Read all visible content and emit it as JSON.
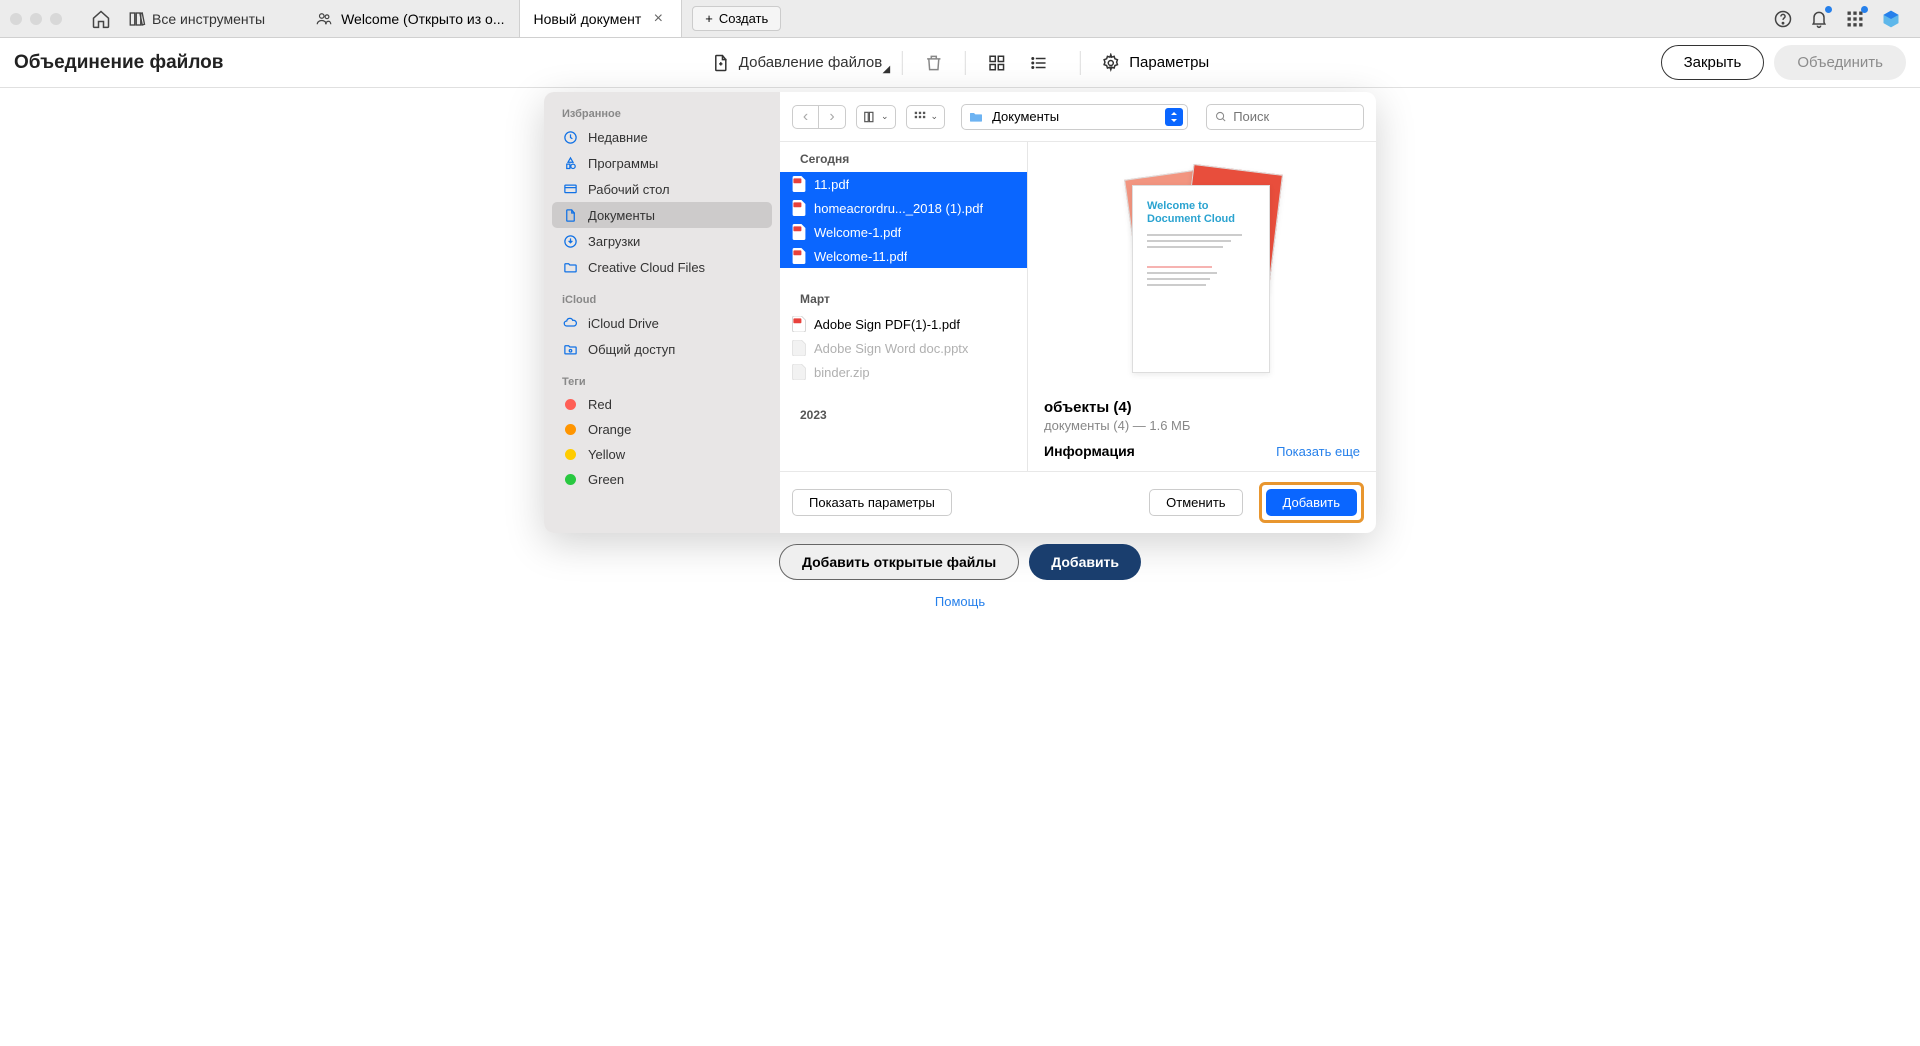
{
  "titlebar": {
    "tools_label": "Все инструменты",
    "tabs": [
      {
        "label": "Welcome (Открыто из о..."
      },
      {
        "label": "Новый документ"
      }
    ],
    "create_label": "Создать"
  },
  "toolbar": {
    "page_title": "Объединение файлов",
    "add_files": "Добавление файлов",
    "params": "Параметры",
    "close": "Закрыть",
    "merge": "Объединить"
  },
  "dialog": {
    "sidebar": {
      "favorites_label": "Избранное",
      "favorites": [
        {
          "icon": "clock",
          "label": "Недавние"
        },
        {
          "icon": "app",
          "label": "Программы"
        },
        {
          "icon": "desktop",
          "label": "Рабочий стол"
        },
        {
          "icon": "doc",
          "label": "Документы",
          "active": true
        },
        {
          "icon": "download",
          "label": "Загрузки"
        },
        {
          "icon": "folder",
          "label": "Creative Cloud Files"
        }
      ],
      "icloud_label": "iCloud",
      "icloud": [
        {
          "icon": "cloud",
          "label": "iCloud Drive"
        },
        {
          "icon": "share",
          "label": "Общий доступ"
        }
      ],
      "tags_label": "Теги",
      "tags": [
        {
          "color": "#ff5f56",
          "label": "Red"
        },
        {
          "color": "#ff9500",
          "label": "Orange"
        },
        {
          "color": "#ffcc00",
          "label": "Yellow"
        },
        {
          "color": "#28c840",
          "label": "Green"
        }
      ]
    },
    "path": "Документы",
    "search_placeholder": "Поиск",
    "groups": [
      {
        "label": "Сегодня",
        "files": [
          {
            "name": "11.pdf",
            "type": "pdf",
            "selected": true
          },
          {
            "name": "homeacrordru..._2018 (1).pdf",
            "type": "pdf",
            "selected": true
          },
          {
            "name": "Welcome-1.pdf",
            "type": "pdf",
            "selected": true
          },
          {
            "name": "Welcome-11.pdf",
            "type": "pdf",
            "selected": true
          }
        ]
      },
      {
        "label": "Март",
        "files": [
          {
            "name": "Adobe Sign PDF(1)-1.pdf",
            "type": "pdf",
            "selected": false
          },
          {
            "name": "Adobe Sign Word doc.pptx",
            "type": "other",
            "selected": false,
            "dimmed": true
          },
          {
            "name": "binder.zip",
            "type": "zip",
            "selected": false,
            "dimmed": true
          }
        ]
      },
      {
        "label": "2023",
        "files": []
      }
    ],
    "preview": {
      "doc_heading1": "Welcome to",
      "doc_heading2": "Document Cloud",
      "title": "объекты (4)",
      "subtitle": "документы (4) — 1.6 МБ",
      "info": "Информация",
      "show_more": "Показать еще"
    },
    "footer": {
      "show_params": "Показать параметры",
      "cancel": "Отменить",
      "add": "Добавить"
    }
  },
  "below": {
    "add_open": "Добавить открытые файлы",
    "add": "Добавить",
    "help": "Помощь"
  }
}
